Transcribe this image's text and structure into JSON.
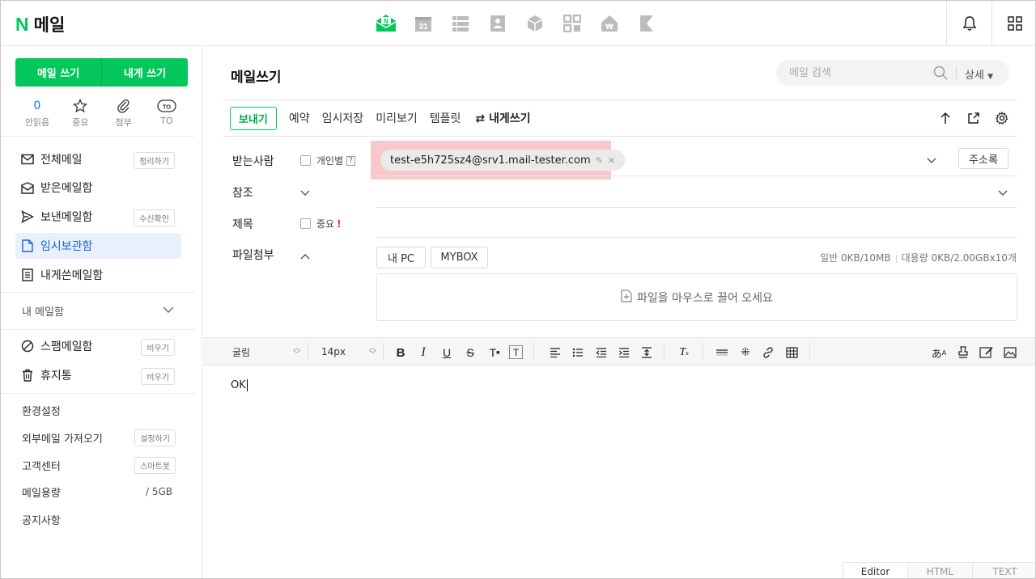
{
  "app": {
    "logo_n": "N",
    "logo_text": "메일"
  },
  "sidebar": {
    "write_mail": "메일 쓰기",
    "write_to_me": "내게 쓰기",
    "quick": [
      {
        "value": "0",
        "label": "안읽음"
      },
      {
        "value": "star-icon",
        "label": "중요"
      },
      {
        "value": "clip-icon",
        "label": "첨부"
      },
      {
        "value": "TO",
        "label": "TO"
      }
    ],
    "folders": [
      {
        "label": "전체메일",
        "badge": "정리하기"
      },
      {
        "label": "받은메일함",
        "badge": ""
      },
      {
        "label": "보낸메일함",
        "badge": "수신확인"
      },
      {
        "label": "임시보관함",
        "badge": ""
      },
      {
        "label": "내게쓴메일함",
        "badge": ""
      }
    ],
    "my_folders": "내 메일함",
    "spam": {
      "label": "스팸메일함",
      "badge": "비우기"
    },
    "trash": {
      "label": "휴지통",
      "badge": "비우기"
    },
    "settings": "환경설정",
    "external": {
      "label": "외부메일 가져오기",
      "badge": "설정하기"
    },
    "support": {
      "label": "고객센터",
      "badge": "스마트봇"
    },
    "usage": {
      "label": "메일용량",
      "value": "/ 5GB"
    },
    "notice": "공지사항"
  },
  "main": {
    "title": "메일쓰기",
    "search_placeholder": "메일 검색",
    "search_detail": "상세",
    "toolbar": {
      "send": "보내기",
      "items": [
        "예약",
        "임시저장",
        "미리보기",
        "템플릿"
      ],
      "self": "내게쓰기"
    },
    "to_label": "받는사람",
    "personal": "개인별",
    "help": "?",
    "recipient": "test-e5h725sz4@srv1.mail-tester.com",
    "address_book": "주소록",
    "cc_label": "참조",
    "subject_label": "제목",
    "important": "중요",
    "important_mark": "!",
    "attach_label": "파일첨부",
    "my_pc": "내 PC",
    "mybox": "MYBOX",
    "size_normal": "일반 0KB/10MB",
    "size_large": "대용량 0KB/2.00GBx10개",
    "dropzone": "파일을 마우스로 끌어 오세요",
    "editor": {
      "font": "굴림",
      "size": "14px"
    },
    "body": "OK",
    "modes": [
      "Editor",
      "HTML",
      "TEXT"
    ]
  },
  "colors": {
    "brand": "#03c75a",
    "active_folder_bg": "#e8f0fb",
    "highlight": "#f6c0c4"
  }
}
